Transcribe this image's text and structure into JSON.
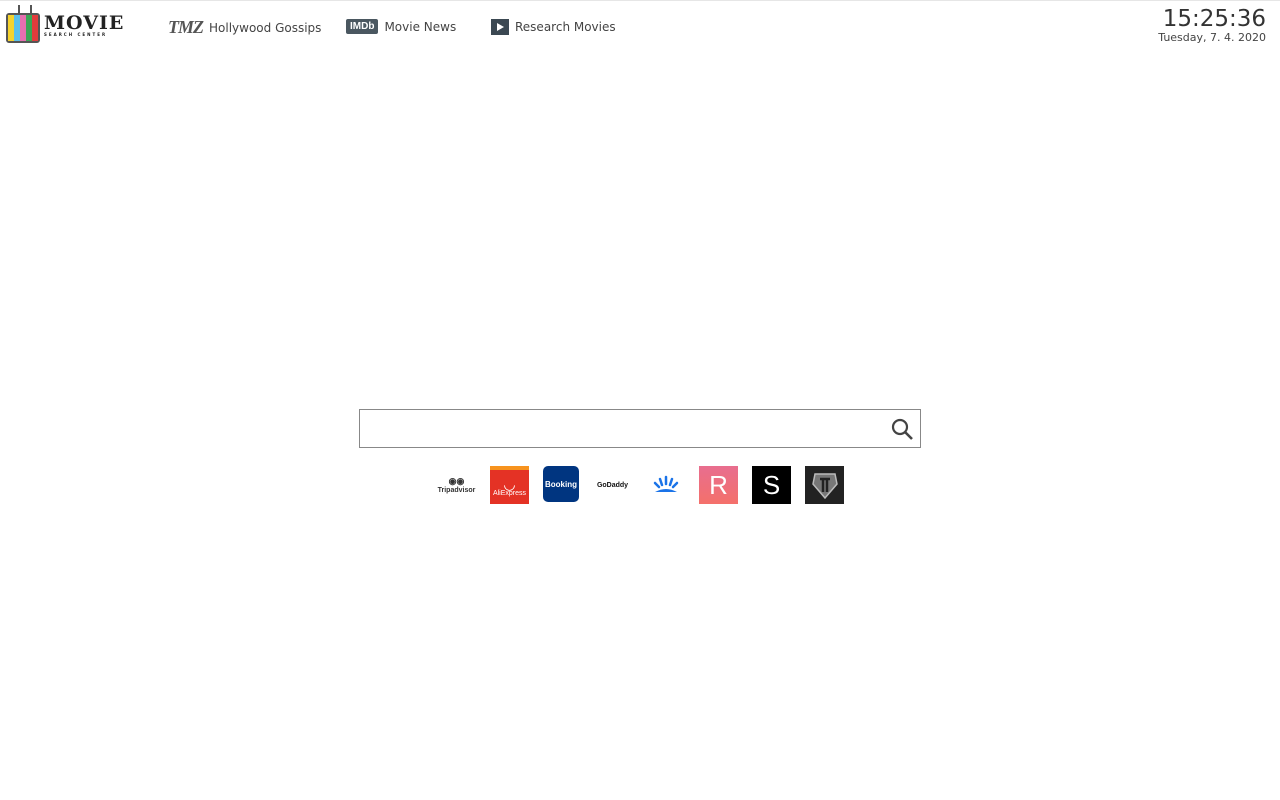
{
  "logo": {
    "title": "MOVIE",
    "subtitle": "SEARCH CENTER"
  },
  "nav": [
    {
      "icon": "tmz-logo",
      "icon_text": "TMZ",
      "label": "Hollywood Gossips"
    },
    {
      "icon": "imdb-logo",
      "icon_text": "IMDb",
      "label": "Movie News"
    },
    {
      "icon": "film-play-icon",
      "label": "Research Movies"
    }
  ],
  "clock": {
    "time": "15:25:36",
    "date": "Tuesday, 7. 4. 2020"
  },
  "search": {
    "value": "",
    "placeholder": ""
  },
  "tiles": [
    {
      "name": "Tripadvisor",
      "label": "Tripadvisor",
      "bg": "#ffffff"
    },
    {
      "name": "AliExpress",
      "label": "AliExpress",
      "bg": "#e43225"
    },
    {
      "name": "Booking",
      "label": "Booking",
      "bg": "#003580"
    },
    {
      "name": "GoDaddy",
      "label": "GoDaddy",
      "bg": "#ffffff"
    },
    {
      "name": "Sunrise app",
      "label": "",
      "bg": "#ffffff"
    },
    {
      "name": "R app",
      "label": "R",
      "bg": "#ee6a7c"
    },
    {
      "name": "S app",
      "label": "S",
      "bg": "#000000"
    },
    {
      "name": "World of Tanks",
      "label": "",
      "bg": "#222222"
    }
  ]
}
